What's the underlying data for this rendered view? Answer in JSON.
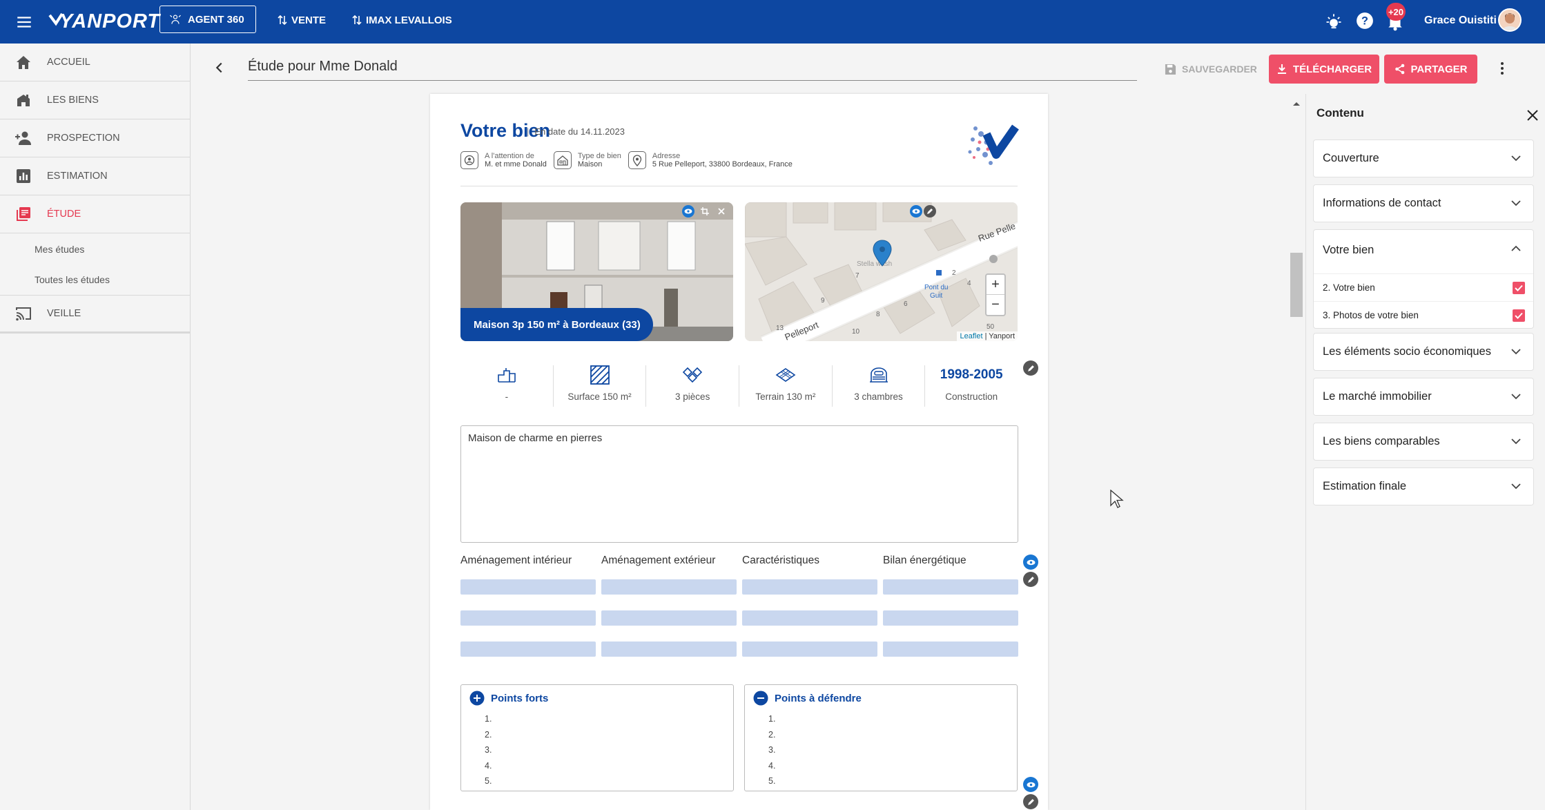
{
  "topbar": {
    "logo_text": "YANPORT",
    "agent_button": "AGENT 360",
    "nav": [
      {
        "label": "VENTE"
      },
      {
        "label": "IMAX LEVALLOIS"
      }
    ],
    "notification_count": "+20",
    "user_name": "Grace Ouistiti",
    "icons": [
      "menu-icon",
      "bulb-icon",
      "help-icon",
      "bell-icon"
    ]
  },
  "sidebar": {
    "items": [
      {
        "label": "ACCUEIL",
        "icon": "home-icon"
      },
      {
        "label": "LES BIENS",
        "icon": "buildings-icon"
      },
      {
        "label": "PROSPECTION",
        "icon": "person-add-icon"
      },
      {
        "label": "ESTIMATION",
        "icon": "bar-chart-icon"
      },
      {
        "label": "ÉTUDE",
        "icon": "document-icon",
        "active": true
      },
      {
        "label": "VEILLE",
        "icon": "cast-icon"
      }
    ],
    "sub_items": [
      {
        "label": "Mes études"
      },
      {
        "label": "Toutes les études"
      }
    ]
  },
  "toolbar": {
    "title": "Étude pour Mme Donald",
    "save_label": "SAUVEGARDER",
    "download_label": "TÉLÉCHARGER",
    "share_label": "PARTAGER"
  },
  "document": {
    "heading": "Votre bien",
    "date": "En date du 14.11.2023",
    "info": [
      {
        "label": "A l'attention de",
        "value": "M. et mme Donald"
      },
      {
        "label": "Type de bien",
        "value": "Maison"
      },
      {
        "label": "Adresse",
        "value": "5 Rue Pelleport, 33800 Bordeaux, France"
      }
    ],
    "photo_caption": "Maison 3p 150 m² à Bordeaux (33)",
    "map": {
      "attribution_leaflet": "Leaflet",
      "attribution_sep": " | Yanport",
      "street_1": "Rue Pelle",
      "street_2": "Pelleport",
      "place_1": "Stella wash",
      "place_2": "Pont du",
      "place_3": "Guit",
      "zoom_in": "+",
      "zoom_out": "−"
    },
    "specs": [
      {
        "value": "-",
        "icon": "floors-icon"
      },
      {
        "value": "Surface 150 m²",
        "icon": "surface-icon"
      },
      {
        "value": "3 pièces",
        "icon": "rooms-icon"
      },
      {
        "value": "Terrain 130 m²",
        "icon": "land-icon"
      },
      {
        "value": "3 chambres",
        "icon": "bed-icon"
      },
      {
        "value": "Construction",
        "years": "1998-2005"
      }
    ],
    "description": "Maison de charme en pierres",
    "amenities_headers": [
      "Aménagement intérieur",
      "Aménagement extérieur",
      "Caractéristiques",
      "Bilan énergétique"
    ],
    "points_forts": {
      "title": "Points forts",
      "items": [
        "1.",
        "2.",
        "3.",
        "4.",
        "5."
      ]
    },
    "points_defendre": {
      "title": "Points à défendre",
      "items": [
        "1.",
        "2.",
        "3.",
        "4.",
        "5."
      ]
    }
  },
  "panel": {
    "title": "Contenu",
    "sections": [
      {
        "label": "Couverture"
      },
      {
        "label": "Informations de contact"
      },
      {
        "label": "Votre bien",
        "open": true,
        "children": [
          {
            "label": "2. Votre bien",
            "checked": true
          },
          {
            "label": "3. Photos de votre bien",
            "checked": true
          }
        ]
      },
      {
        "label": "Les éléments socio économiques"
      },
      {
        "label": "Le marché immobilier"
      },
      {
        "label": "Les biens comparables"
      },
      {
        "label": "Estimation finale"
      }
    ]
  },
  "colors": {
    "brand": "#0d47a1",
    "accent": "#ef4f68",
    "active_nav": "#e53950"
  }
}
